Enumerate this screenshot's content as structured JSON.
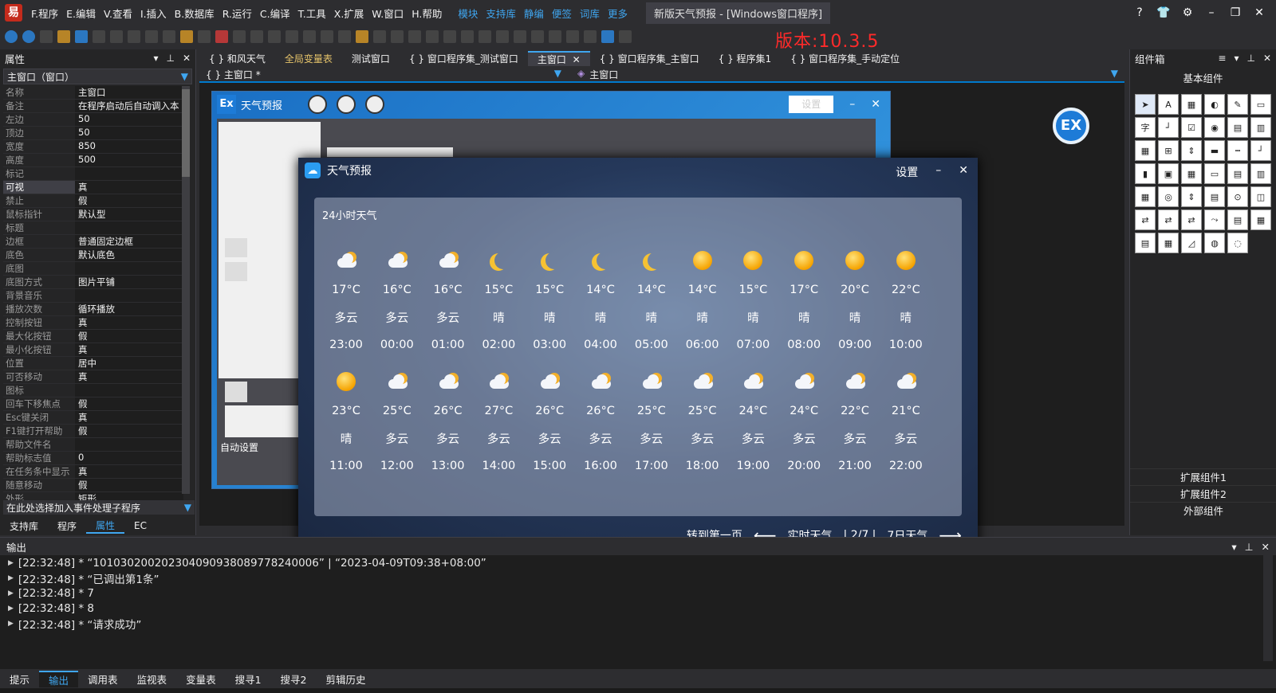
{
  "menubar": {
    "items": [
      "F.程序",
      "E.编辑",
      "V.查看",
      "I.插入",
      "B.数据库",
      "R.运行",
      "C.编译",
      "T.工具",
      "X.扩展",
      "W.窗口",
      "H.帮助"
    ],
    "links": [
      "模块",
      "支持库",
      "静编",
      "便签",
      "词库",
      "更多"
    ],
    "doc_title": "新版天气预报 - [Windows窗口程序]",
    "window_controls": [
      "?",
      "shirt-icon",
      "gear-icon",
      "–",
      "❐",
      "✕"
    ]
  },
  "toolbar": {
    "version_label": "版本:10.3.5"
  },
  "left_panel": {
    "title": "属性",
    "selector": "主窗口（窗口）",
    "properties": [
      {
        "k": "名称",
        "v": "主窗口"
      },
      {
        "k": "备注",
        "v": "在程序启动后自动调入本"
      },
      {
        "k": "左边",
        "v": "50"
      },
      {
        "k": "顶边",
        "v": "50"
      },
      {
        "k": "宽度",
        "v": "850"
      },
      {
        "k": "高度",
        "v": "500"
      },
      {
        "k": "标记",
        "v": ""
      },
      {
        "k": "可视",
        "v": "真"
      },
      {
        "k": "禁止",
        "v": "假"
      },
      {
        "k": "鼠标指针",
        "v": "默认型"
      },
      {
        "k": "标题",
        "v": ""
      },
      {
        "k": "边框",
        "v": "普通固定边框"
      },
      {
        "k": "底色",
        "v": "默认底色"
      },
      {
        "k": "底图",
        "v": ""
      },
      {
        "k": "  底图方式",
        "v": "图片平铺"
      },
      {
        "k": "背景音乐",
        "v": ""
      },
      {
        "k": "  播放次数",
        "v": "循环播放"
      },
      {
        "k": "控制按钮",
        "v": "真"
      },
      {
        "k": "  最大化按钮",
        "v": "假"
      },
      {
        "k": "  最小化按钮",
        "v": "真"
      },
      {
        "k": "位置",
        "v": "居中"
      },
      {
        "k": "可否移动",
        "v": "真"
      },
      {
        "k": "图标",
        "v": ""
      },
      {
        "k": "回车下移焦点",
        "v": "假"
      },
      {
        "k": "Esc键关闭",
        "v": "真"
      },
      {
        "k": "F1键打开帮助",
        "v": "假"
      },
      {
        "k": "  帮助文件名",
        "v": ""
      },
      {
        "k": "  帮助标志值",
        "v": "0"
      },
      {
        "k": "在任务条中显示",
        "v": "真"
      },
      {
        "k": "随意移动",
        "v": "假"
      },
      {
        "k": "外形",
        "v": "矩形"
      }
    ],
    "event_selector": "在此处选择加入事件处理子程序",
    "tabs": [
      "支持库",
      "程序",
      "属性",
      "EC"
    ],
    "active_tab": "属性"
  },
  "doc_tabs": [
    {
      "label": "{ } 和风天气"
    },
    {
      "label": "全局变量表"
    },
    {
      "label": "测试窗口"
    },
    {
      "label": "{ } 窗口程序集_测试窗口"
    },
    {
      "label": "主窗口"
    },
    {
      "label": "{ } 窗口程序集_主窗口"
    },
    {
      "label": "{ } 程序集1"
    },
    {
      "label": "{ } 窗口程序集_手动定位"
    }
  ],
  "doc_bar": {
    "left": "{ } 主窗口 *",
    "right": "主窗口"
  },
  "design_form": {
    "title": "天气预报",
    "settings_label": "设置",
    "bottom_label": "自动设置"
  },
  "weather": {
    "title": "天气预报",
    "settings": "设置",
    "panel_title": "24小时天气",
    "row1": [
      {
        "icon": "cloud",
        "temp": "17°C",
        "desc": "多云",
        "time": "23:00"
      },
      {
        "icon": "cloud",
        "temp": "16°C",
        "desc": "多云",
        "time": "00:00"
      },
      {
        "icon": "cloud",
        "temp": "16°C",
        "desc": "多云",
        "time": "01:00"
      },
      {
        "icon": "moon",
        "temp": "15°C",
        "desc": "晴",
        "time": "02:00"
      },
      {
        "icon": "moon",
        "temp": "15°C",
        "desc": "晴",
        "time": "03:00"
      },
      {
        "icon": "moon",
        "temp": "14°C",
        "desc": "晴",
        "time": "04:00"
      },
      {
        "icon": "moon",
        "temp": "14°C",
        "desc": "晴",
        "time": "05:00"
      },
      {
        "icon": "sun",
        "temp": "14°C",
        "desc": "晴",
        "time": "06:00"
      },
      {
        "icon": "sun",
        "temp": "15°C",
        "desc": "晴",
        "time": "07:00"
      },
      {
        "icon": "sun",
        "temp": "17°C",
        "desc": "晴",
        "time": "08:00"
      },
      {
        "icon": "sun",
        "temp": "20°C",
        "desc": "晴",
        "time": "09:00"
      },
      {
        "icon": "sun",
        "temp": "22°C",
        "desc": "晴",
        "time": "10:00"
      }
    ],
    "row2": [
      {
        "icon": "sun",
        "temp": "23°C",
        "desc": "晴",
        "time": "11:00"
      },
      {
        "icon": "cloud",
        "temp": "25°C",
        "desc": "多云",
        "time": "12:00"
      },
      {
        "icon": "cloud",
        "temp": "26°C",
        "desc": "多云",
        "time": "13:00"
      },
      {
        "icon": "cloud",
        "temp": "27°C",
        "desc": "多云",
        "time": "14:00"
      },
      {
        "icon": "cloud",
        "temp": "26°C",
        "desc": "多云",
        "time": "15:00"
      },
      {
        "icon": "cloud",
        "temp": "26°C",
        "desc": "多云",
        "time": "16:00"
      },
      {
        "icon": "cloud",
        "temp": "25°C",
        "desc": "多云",
        "time": "17:00"
      },
      {
        "icon": "cloud",
        "temp": "25°C",
        "desc": "多云",
        "time": "18:00"
      },
      {
        "icon": "cloud",
        "temp": "24°C",
        "desc": "多云",
        "time": "19:00"
      },
      {
        "icon": "cloud",
        "temp": "24°C",
        "desc": "多云",
        "time": "20:00"
      },
      {
        "icon": "cloud",
        "temp": "22°C",
        "desc": "多云",
        "time": "21:00"
      },
      {
        "icon": "cloud",
        "temp": "21°C",
        "desc": "多云",
        "time": "22:00"
      }
    ],
    "footer": {
      "first_page": "转到第一页",
      "realtime": "实时天气",
      "page": "| 2/7 |",
      "seven_day": "7日天气"
    }
  },
  "right_panel": {
    "title": "组件箱",
    "category": "基本组件",
    "extra_categories": [
      "扩展组件1",
      "扩展组件2",
      "外部组件"
    ]
  },
  "output": {
    "title": "输出",
    "lines": [
      "[22:32:48] *  “101030200202304090938089778240006”  |  “2023-04-09T09:38+08:00”",
      "[22:32:48] *  “已调出第1条”",
      "[22:32:48] * 7",
      "[22:32:48] * 8",
      "[22:32:48] *  “请求成功”"
    ]
  },
  "bottom_tabs": [
    "提示",
    "输出",
    "调用表",
    "监视表",
    "变量表",
    "搜寻1",
    "搜寻2",
    "剪辑历史"
  ],
  "bottom_active": "输出"
}
